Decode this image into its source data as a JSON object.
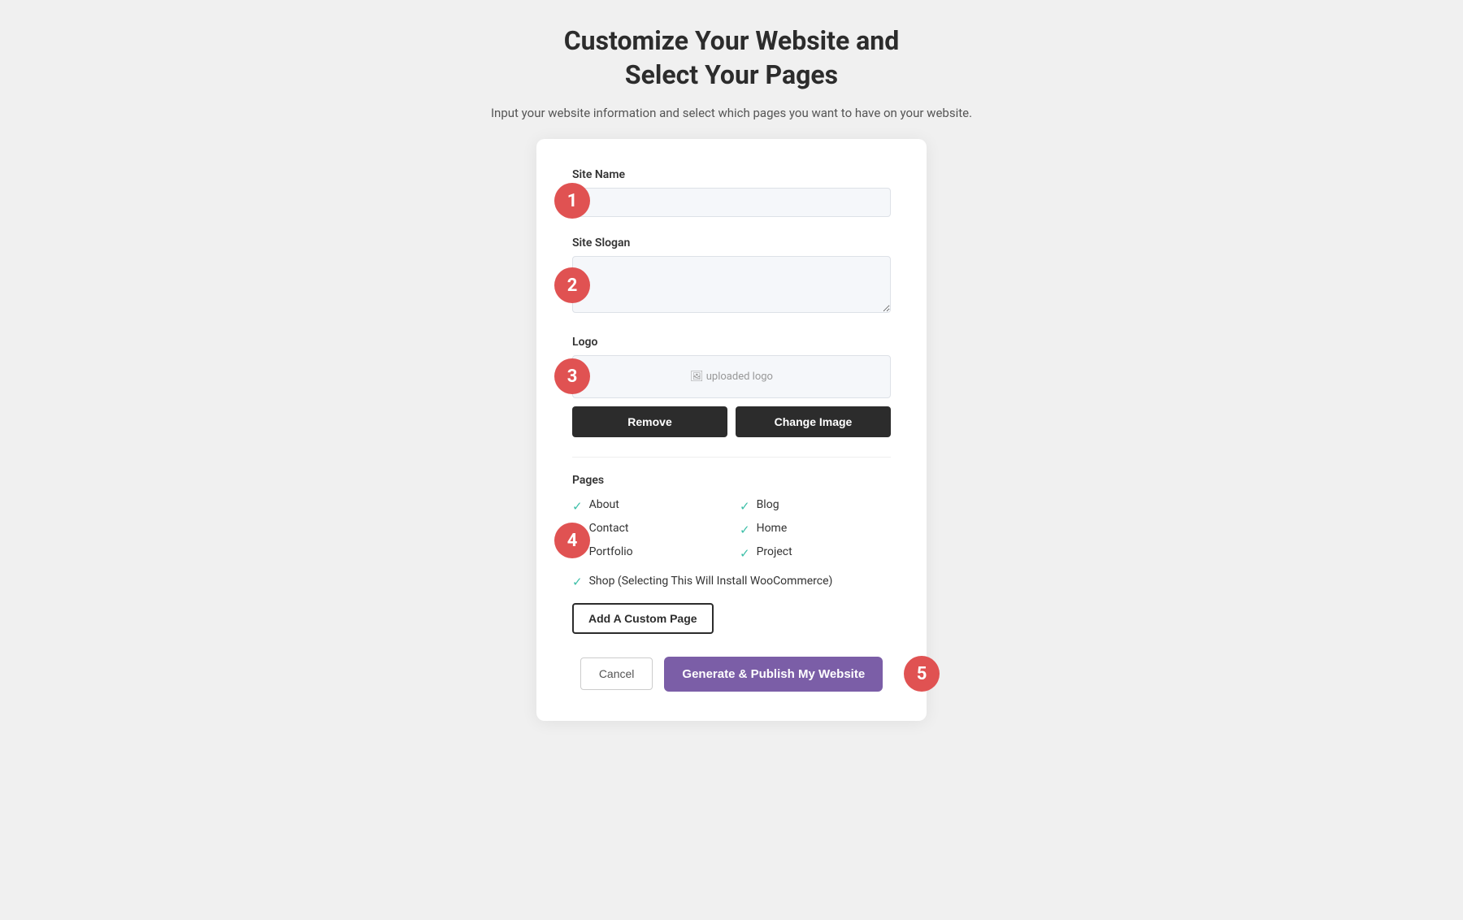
{
  "header": {
    "title_line1": "Customize Your Website and",
    "title_line2": "Select Your Pages",
    "subtitle": "Input your website information and select which pages you want to have on your website."
  },
  "steps": {
    "step1": "1",
    "step2": "2",
    "step3": "3",
    "step4": "4",
    "step5": "5"
  },
  "fields": {
    "site_name_label": "Site Name",
    "site_name_placeholder": "",
    "site_slogan_label": "Site Slogan",
    "site_slogan_placeholder": "",
    "logo_label": "Logo",
    "logo_preview_text": "uploaded logo"
  },
  "buttons": {
    "remove_label": "Remove",
    "change_image_label": "Change Image",
    "add_custom_page_label": "Add A Custom Page",
    "cancel_label": "Cancel",
    "generate_label": "Generate & Publish My Website"
  },
  "pages": {
    "section_label": "Pages",
    "items": [
      {
        "label": "About",
        "checked": true
      },
      {
        "label": "Blog",
        "checked": true
      },
      {
        "label": "Contact",
        "checked": true
      },
      {
        "label": "Home",
        "checked": true
      },
      {
        "label": "Portfolio",
        "checked": true
      },
      {
        "label": "Project",
        "checked": true
      }
    ],
    "shop_label": "Shop (Selecting This Will Install WooCommerce)",
    "shop_checked": true
  },
  "colors": {
    "badge_bg": "#e05252",
    "check_color": "#3dbfa8",
    "generate_btn_bg": "#7b5ea7"
  }
}
